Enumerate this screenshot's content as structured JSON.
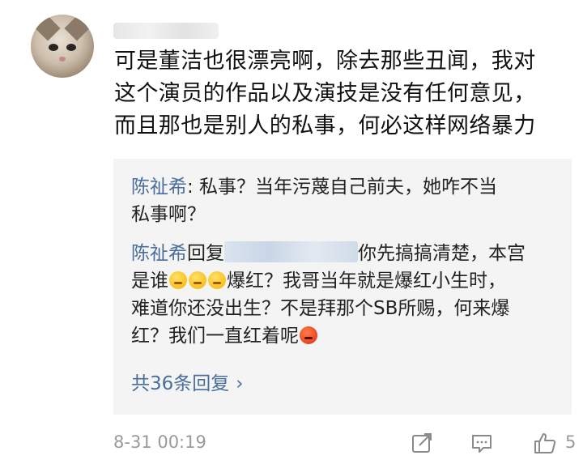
{
  "comment": {
    "lines": [
      "可是董洁也很漂亮啊，除去那些丑闻，我对",
      "这个演员的作品以及演技是没有任何意见，",
      "而且那也是别人的私事，何必这样网络暴力"
    ]
  },
  "replies": [
    {
      "user": "陈祉希",
      "line1_rest": ": 私事？当年污蔑自己前夫，她咋不当",
      "line2": "私事啊？"
    },
    {
      "user": "陈祉希",
      "reply_word": "回复",
      "line1_tail": "你先搞搞清楚，本宫",
      "line2_a": "是谁",
      "line2_b": "爆红？我哥当年就是爆红小生时，",
      "line3": "难道你还没出生？不是拜那个SB所赐，何来爆",
      "line4": "红？我们一直红着呢"
    }
  ],
  "more_replies": {
    "label": "共36条回复",
    "chevron": "›"
  },
  "footer": {
    "timestamp": "8-31 00:19",
    "like_count": "5",
    "icons": [
      "share-icon",
      "comment-icon",
      "like-icon"
    ]
  },
  "colors": {
    "link": "#4a6e9b",
    "meta": "#9a9a9a",
    "reply_bg": "#f4f4f4"
  }
}
